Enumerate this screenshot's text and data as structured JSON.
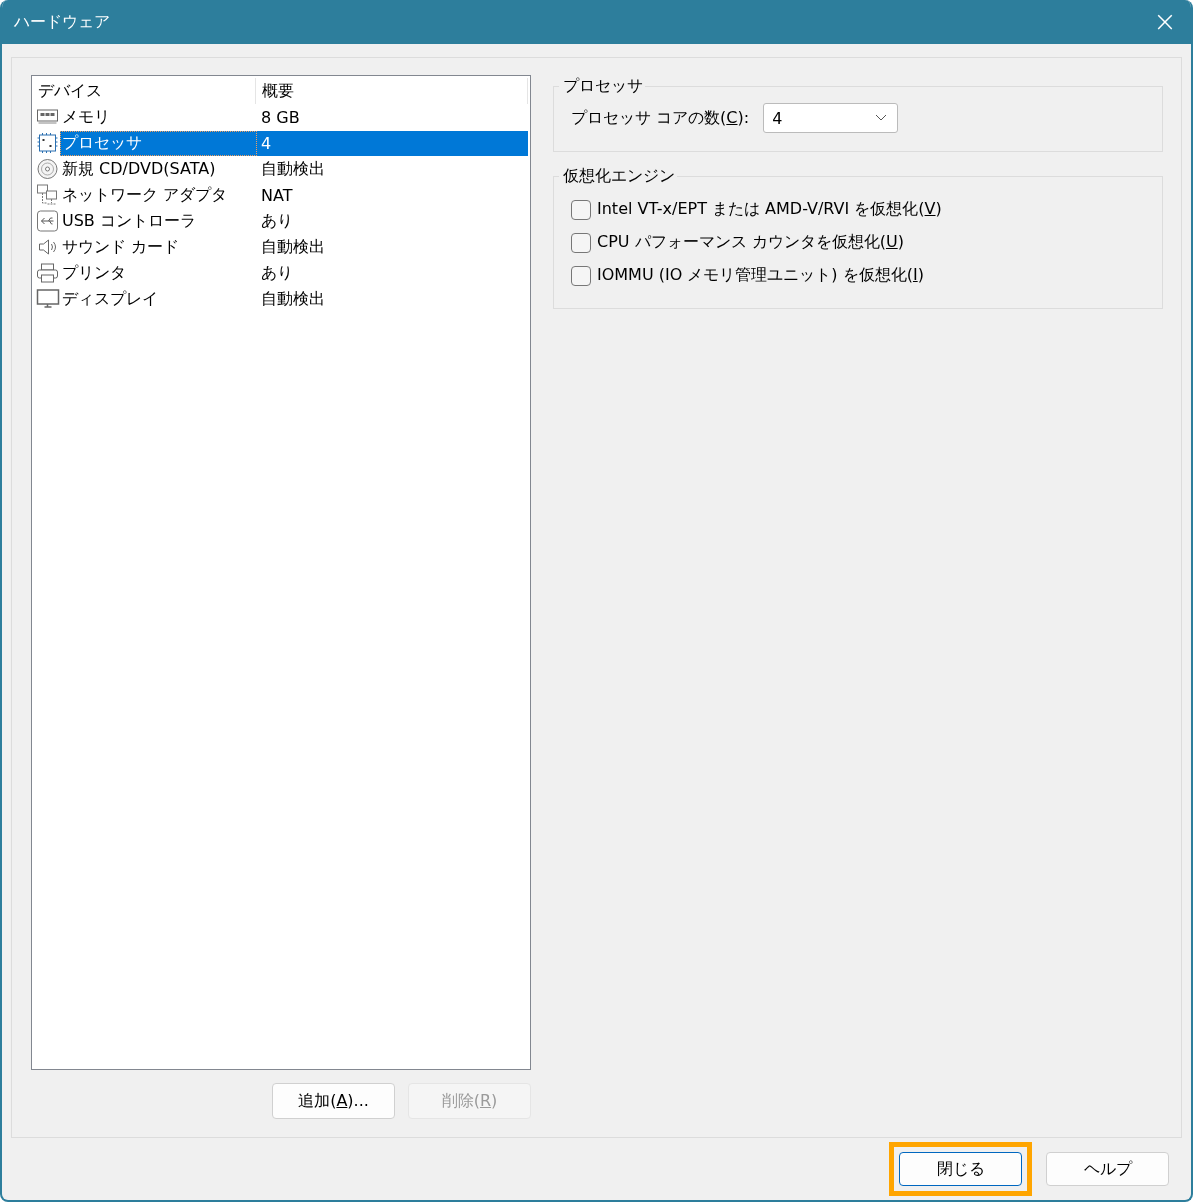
{
  "window": {
    "title": "ハードウェア",
    "close": "×"
  },
  "device_table": {
    "columns": [
      "デバイス",
      "概要"
    ],
    "rows": [
      {
        "kind": "memory",
        "device": "メモリ",
        "summary": "8 GB",
        "selected": false
      },
      {
        "kind": "processor",
        "device": "プロセッサ",
        "summary": "4",
        "selected": true
      },
      {
        "kind": "cdrom",
        "device": "新規 CD/DVD(SATA)",
        "summary": "自動検出",
        "selected": false
      },
      {
        "kind": "network",
        "device": "ネットワーク アダプタ",
        "summary": "NAT",
        "selected": false
      },
      {
        "kind": "usb",
        "device": "USB コントローラ",
        "summary": "あり",
        "selected": false
      },
      {
        "kind": "sound",
        "device": "サウンド カード",
        "summary": "自動検出",
        "selected": false
      },
      {
        "kind": "printer",
        "device": "プリンタ",
        "summary": "あり",
        "selected": false
      },
      {
        "kind": "display",
        "device": "ディスプレイ",
        "summary": "自動検出",
        "selected": false
      }
    ]
  },
  "list_buttons": [
    {
      "label": "追加(",
      "access_key": "A",
      "label_end": ")...",
      "disabled": false
    },
    {
      "label": "削除(",
      "access_key": "R",
      "label_end": ")",
      "disabled": true
    }
  ],
  "processor_group": {
    "title": "プロセッサ",
    "cores_label": "プロセッサ コアの数(",
    "cores_access_key": "C",
    "cores_label_end": "):",
    "cores_value": "4"
  },
  "virtualization_group": {
    "title": "仮想化エンジン",
    "options": [
      {
        "label": "Intel VT-x/EPT または AMD-V/RVI を仮想化(",
        "access_key": "V",
        "label_end": ")",
        "checked": false
      },
      {
        "label": "CPU パフォーマンス カウンタを仮想化(",
        "access_key": "U",
        "label_end": ")",
        "checked": false
      },
      {
        "label": "IOMMU (IO メモリ管理ユニット) を仮想化(",
        "access_key": "I",
        "label_end": ")",
        "checked": false
      }
    ]
  },
  "footer_buttons": [
    {
      "label": "閉じる",
      "highlighted": true
    },
    {
      "label": "ヘルプ",
      "highlighted": false
    }
  ]
}
